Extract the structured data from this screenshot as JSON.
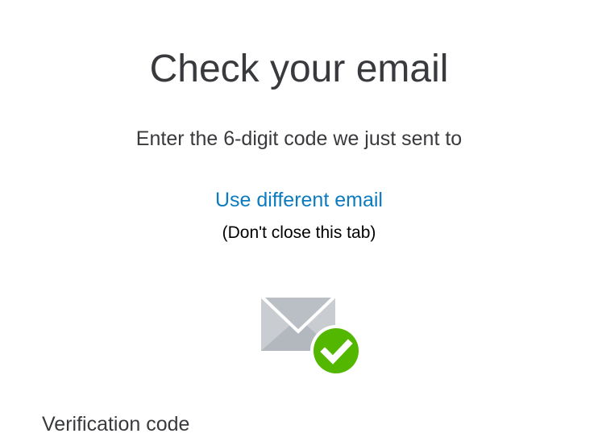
{
  "page": {
    "title": "Check your email",
    "subtitle": "Enter the 6-digit code we just sent to",
    "link_label": "Use different email",
    "note": "(Don't close this tab)",
    "field_label": "Verification code"
  },
  "icons": {
    "illustration": "envelope-icon",
    "badge": "checkmark-icon"
  },
  "colors": {
    "text": "#393a3d",
    "link": "#0d7bbf",
    "envelope": "#babec5",
    "check_badge": "#53b700"
  }
}
